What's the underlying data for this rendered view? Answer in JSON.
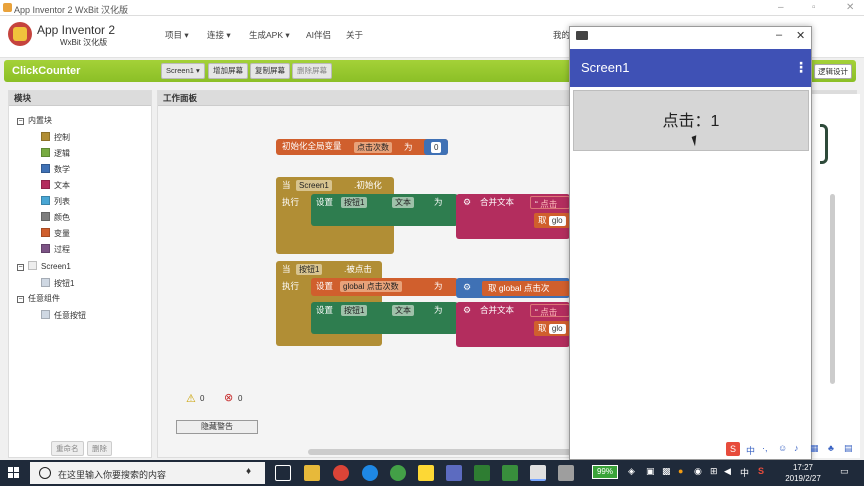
{
  "window": {
    "title": "App Inventor 2 WxBit 汉化版"
  },
  "header": {
    "brand_name": "App Inventor 2",
    "brand_sub": "WxBit 汉化版",
    "menu": [
      "项目 ▾",
      "连接 ▾",
      "生成APK ▾",
      "AI伴侣",
      "关于"
    ],
    "mine": "我的"
  },
  "project": {
    "name": "ClickCounter",
    "screen_select": "Screen1 ▾",
    "add_screen": "增加屏幕",
    "copy_screen": "复制屏幕",
    "delete_screen": "删除屏幕",
    "logic_design": "逻辑设计"
  },
  "left": {
    "title": "模块",
    "builtin": "内置块",
    "items": [
      {
        "label": "控制",
        "color": "#b18e35"
      },
      {
        "label": "逻辑",
        "color": "#77ab41"
      },
      {
        "label": "数学",
        "color": "#3f71b5"
      },
      {
        "label": "文本",
        "color": "#b32d5e"
      },
      {
        "label": "列表",
        "color": "#49a6d4"
      },
      {
        "label": "颜色",
        "color": "#7d7d7d"
      },
      {
        "label": "变量",
        "color": "#d05f2d"
      },
      {
        "label": "过程",
        "color": "#7c5385"
      }
    ],
    "screen": "Screen1",
    "button": "按钮1",
    "any_component": "任意组件",
    "any_button": "任意按钮",
    "rename": "重命名",
    "delete": "删除"
  },
  "workspace": {
    "title": "工作面板",
    "init_global": "初始化全局变量",
    "var_name": "点击次数",
    "as": "为",
    "init_value": "0",
    "when": "当",
    "screen1": "Screen1",
    "initialize": ".初始化",
    "do": "执行",
    "set": "设置",
    "button1": "按钮1",
    "dot": ".",
    "text_prop": "文本",
    "to": "为",
    "join": "合并文本",
    "quote": "“",
    "get": "取",
    "get_partial": "glo",
    "quote_partial": "点击",
    "clicked": ".被点击",
    "global_var": "global 点击次数",
    "get_global": "取 global 点击次",
    "warn_count": "0",
    "error_count": "0",
    "hide_warnings": "隐藏警告"
  },
  "phone": {
    "app_title": "Screen1",
    "button_text": "点击：1"
  },
  "taskbar": {
    "search_placeholder": "在这里输入你要搜索的内容",
    "battery": "99%",
    "ime_lang": "中",
    "ime_s": "S",
    "time": "17:27",
    "date": "2019/2/27"
  }
}
